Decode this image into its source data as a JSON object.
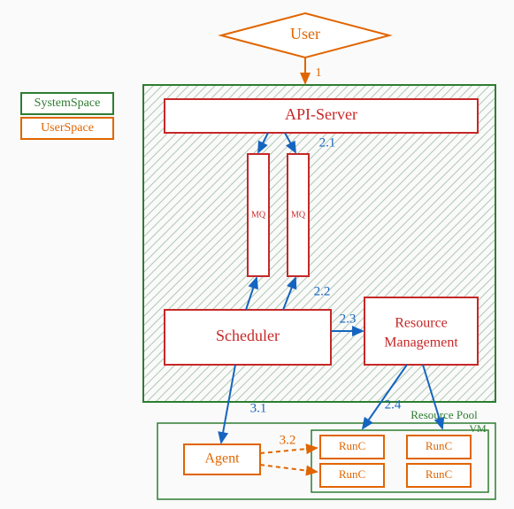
{
  "nodes": {
    "user": "User",
    "api_server": "API-Server",
    "mq1": "MQ",
    "mq2": "MQ",
    "scheduler": "Scheduler",
    "resource_mgmt_1": "Resource",
    "resource_mgmt_2": "Management",
    "agent": "Agent",
    "runc_a": "RunC",
    "runc_b": "RunC",
    "runc_c": "RunC",
    "runc_d": "RunC"
  },
  "containers": {
    "resource_pool": "Resource Pool",
    "vm": "VM"
  },
  "legend": {
    "system_space": "SystemSpace",
    "user_space": "UserSpace"
  },
  "edges": {
    "e1": "1",
    "e21": "2.1",
    "e22": "2.2",
    "e23": "2.3",
    "e24": "2.4",
    "e31": "3.1",
    "e32": "3.2"
  }
}
